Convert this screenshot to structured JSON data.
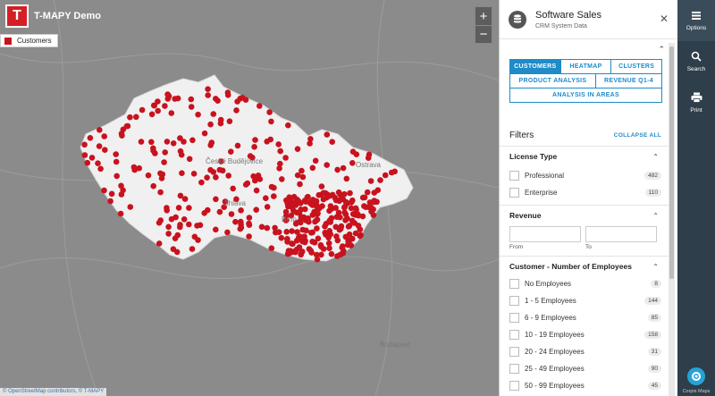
{
  "app": {
    "title": "T-MAPY Demo",
    "logo_letter": "T"
  },
  "legend": {
    "label": "Customers",
    "color": "#c8121e"
  },
  "zoom": {
    "in": "+",
    "out": "−"
  },
  "map": {
    "attribution": "© OpenStreetMap contributors, © T-MAPY",
    "city_labels": [
      "Jihlava",
      "České Budějovice",
      "Brno",
      "Ostrava",
      "Budapest"
    ]
  },
  "panel": {
    "title": "Software Sales",
    "subtitle": "CRM System Data",
    "tabs_row1": [
      "CUSTOMERS",
      "HEATMAP",
      "CLUSTERS"
    ],
    "tabs_row2": [
      "PRODUCT ANALYSIS",
      "REVENUE Q1-4"
    ],
    "tabs_row3": [
      "ANALYSIS IN AREAS"
    ],
    "active_tab": "CUSTOMERS",
    "filters_title": "Filters",
    "collapse_all": "COLLAPSE ALL",
    "license": {
      "title": "License Type",
      "options": [
        {
          "label": "Professional",
          "count": "482"
        },
        {
          "label": "Enterprise",
          "count": "110"
        }
      ]
    },
    "revenue": {
      "title": "Revenue",
      "from_label": "From",
      "to_label": "To"
    },
    "employees": {
      "title": "Customer - Number of Employees",
      "options": [
        {
          "label": "No Employees",
          "count": "8"
        },
        {
          "label": "1 - 5 Employees",
          "count": "144"
        },
        {
          "label": "6 - 9 Employees",
          "count": "85"
        },
        {
          "label": "10 - 19 Employees",
          "count": "158"
        },
        {
          "label": "20 - 24 Employees",
          "count": "31"
        },
        {
          "label": "25 - 49 Employees",
          "count": "90"
        },
        {
          "label": "50 - 99 Employees",
          "count": "45"
        }
      ]
    }
  },
  "rail": {
    "options": "Options",
    "search": "Search",
    "print": "Print",
    "brand": "Corpis Maps"
  },
  "colors": {
    "accent": "#1f8bc7",
    "marker": "#c8121e",
    "rail": "#2e3e4a"
  }
}
